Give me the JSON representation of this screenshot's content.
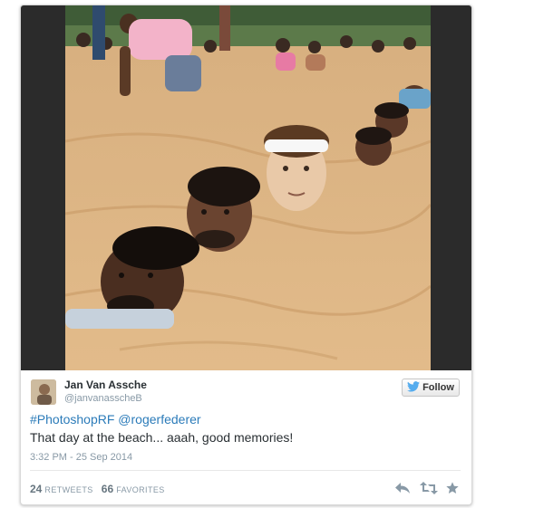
{
  "tweet": {
    "display_name": "Jan Van Assche",
    "screen_name": "@janvanasscheB",
    "follow_label": "Follow",
    "hashtag": "#PhotoshopRF",
    "mention": "@rogerfederer",
    "text": "That day at the beach... aaah, good memories!",
    "timestamp": "3:32 PM - 25 Sep 2014",
    "retweets_count": "24",
    "retweets_label": "RETWEETS",
    "favorites_count": "66",
    "favorites_label": "FAVORITES"
  },
  "colors": {
    "link": "#2b7bb9",
    "muted": "#8899a6",
    "twitter_bird": "#55acee",
    "sand": "#d9ae7a"
  },
  "icons": [
    "twitter-bird-icon",
    "reply-icon",
    "retweet-icon",
    "favorite-star-icon"
  ]
}
